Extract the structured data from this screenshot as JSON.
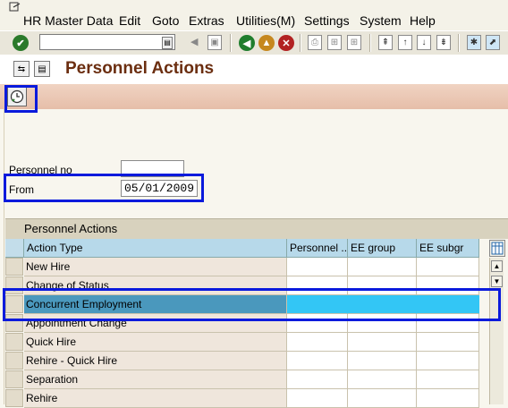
{
  "menu": [
    "HR Master Data",
    "Edit",
    "Goto",
    "Extras",
    "Utilities(M)",
    "Settings",
    "System",
    "Help"
  ],
  "toolbar": {
    "command_value": "",
    "colors": {
      "enter": "#2b7a2b",
      "back": "#1f7d2d",
      "exit": "#c6881f",
      "cancel": "#b22222"
    }
  },
  "title": "Personnel Actions",
  "form": {
    "personnel_no_label": "Personnel no",
    "personnel_no_value": "",
    "from_label": "From",
    "from_value": "05/01/2009"
  },
  "table": {
    "title": "Personnel Actions",
    "columns": [
      "Action Type",
      "Personnel ..",
      "EE group",
      "EE subgr"
    ],
    "rows": [
      {
        "action": "New Hire"
      },
      {
        "action": "Change of Status"
      },
      {
        "action": "Concurrent Employment",
        "selected": true
      },
      {
        "action": "Appointment Change"
      },
      {
        "action": "Quick Hire"
      },
      {
        "action": "Rehire - Quick Hire"
      },
      {
        "action": "Separation"
      },
      {
        "action": "Rehire"
      }
    ]
  },
  "colors": {
    "title": "#6b2e10",
    "highlight": "#0a1adc",
    "header": "#b7d9ea",
    "selected_row": "#4a98bd",
    "selected_cells": "#33c6f5"
  }
}
